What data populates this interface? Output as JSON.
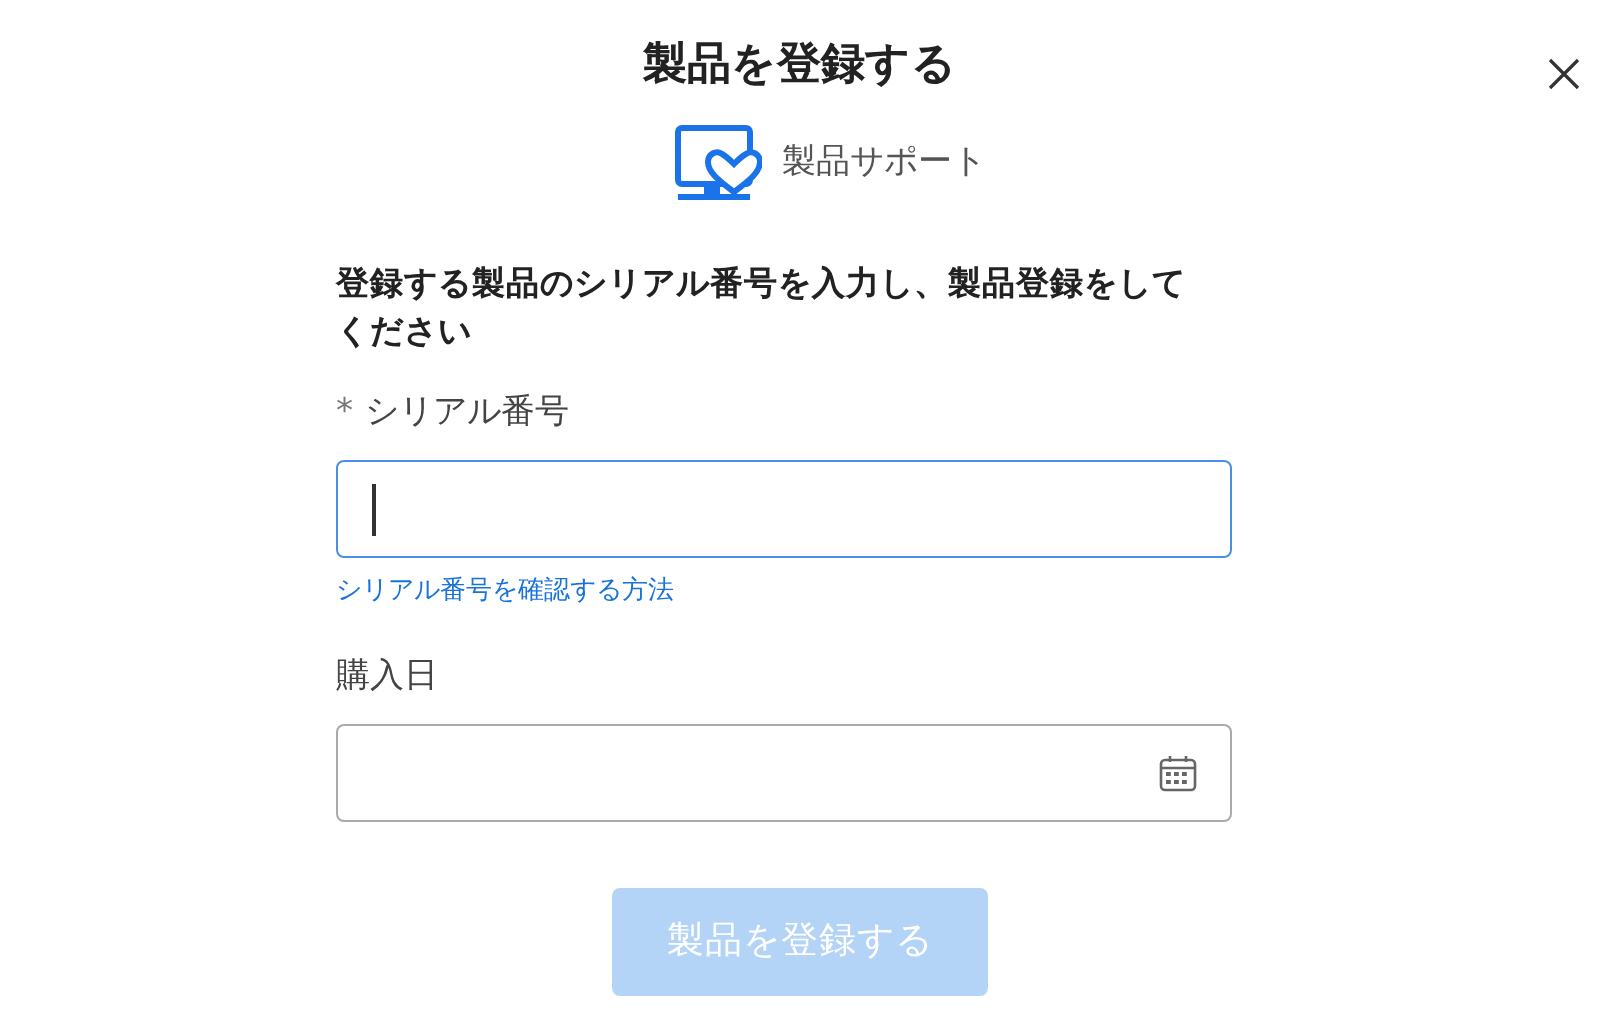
{
  "dialog": {
    "title": "製品を登録する"
  },
  "category": {
    "label": "製品サポート"
  },
  "instruction": "登録する製品のシリアル番号を入力し、製品登録をしてください",
  "fields": [
    {
      "kind": "text",
      "required_mark": "*",
      "label": "シリアル番号",
      "focused": true,
      "help_link": "シリアル番号を確認する方法"
    },
    {
      "kind": "date",
      "label": "購入日",
      "focused": false
    }
  ],
  "submit": {
    "label": "製品を登録する",
    "disabled": true
  }
}
